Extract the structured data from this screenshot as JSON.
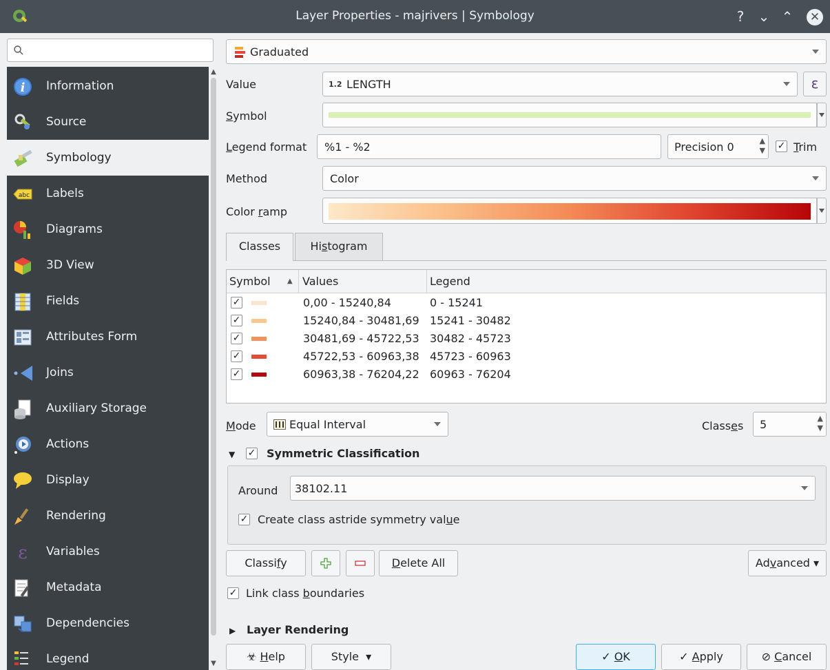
{
  "window": {
    "title": "Layer Properties - majrivers | Symbology"
  },
  "search": {
    "placeholder": ""
  },
  "sidebar": {
    "items": [
      {
        "label": "Information",
        "icon": "info-icon"
      },
      {
        "label": "Source",
        "icon": "source-icon"
      },
      {
        "label": "Symbology",
        "icon": "symbology-brush-icon"
      },
      {
        "label": "Labels",
        "icon": "labels-abc-icon"
      },
      {
        "label": "Diagrams",
        "icon": "diagrams-icon"
      },
      {
        "label": "3D View",
        "icon": "3d-view-cube-icon"
      },
      {
        "label": "Fields",
        "icon": "fields-icon"
      },
      {
        "label": "Attributes Form",
        "icon": "attributes-form-icon"
      },
      {
        "label": "Joins",
        "icon": "joins-icon"
      },
      {
        "label": "Auxiliary Storage",
        "icon": "auxiliary-storage-icon"
      },
      {
        "label": "Actions",
        "icon": "actions-gear-icon"
      },
      {
        "label": "Display",
        "icon": "display-speech-bubble-icon"
      },
      {
        "label": "Rendering",
        "icon": "rendering-brush-icon"
      },
      {
        "label": "Variables",
        "icon": "variables-epsilon-icon"
      },
      {
        "label": "Metadata",
        "icon": "metadata-icon"
      },
      {
        "label": "Dependencies",
        "icon": "dependencies-icon"
      },
      {
        "label": "Legend",
        "icon": "legend-icon"
      }
    ]
  },
  "renderer": {
    "type": "Graduated"
  },
  "form": {
    "value_label": "Value",
    "value_prefix": "1.2",
    "value": "LENGTH",
    "expression_icon": "ε",
    "symbol_label": "Symbol",
    "legend_format_label": "Legend format",
    "legend_format": "%1 - %2",
    "precision": "Precision 0",
    "trim_label": "Trim",
    "method_label": "Method",
    "method": "Color",
    "color_ramp_label": "Color ramp"
  },
  "tabs": [
    {
      "label": "Classes"
    },
    {
      "label": "Histogram"
    }
  ],
  "table": {
    "headers": [
      "Symbol",
      "Values",
      "Legend"
    ],
    "rows": [
      {
        "values": "0,00 - 15240,84",
        "legend": "0 - 15241",
        "color": "#fbe6cf"
      },
      {
        "values": "15240,84 - 30481,69",
        "legend": "15241 - 30482",
        "color": "#fbc68f"
      },
      {
        "values": "30481,69 - 45722,53",
        "legend": "30482 - 45723",
        "color": "#f6905c"
      },
      {
        "values": "45722,53 - 60963,38",
        "legend": "45723 - 60963",
        "color": "#e44b36"
      },
      {
        "values": "60963,38 - 76204,22",
        "legend": "60963 - 76204",
        "color": "#b40a10"
      }
    ]
  },
  "mode": {
    "label": "Mode",
    "value": "Equal Interval",
    "classes_label": "Classes",
    "classes": "5"
  },
  "symmetric": {
    "title": "Symmetric Classification",
    "around_label": "Around",
    "around_value": "38102.11",
    "astride_label": "Create class astride symmetry value"
  },
  "buttons": {
    "classify": "Classify",
    "delete_all": "Delete All",
    "advanced": "Advanced",
    "link_boundaries": "Link class boundaries",
    "layer_rendering": "Layer Rendering",
    "help": "Help",
    "style": "Style",
    "ok": "OK",
    "apply": "Apply",
    "cancel": "Cancel"
  },
  "colors": {
    "symbol_line": "#d8f0b4",
    "ramp_start": "#fde8c8",
    "ramp_end": "#b70508",
    "sidebar_bg": "#3b4045"
  }
}
